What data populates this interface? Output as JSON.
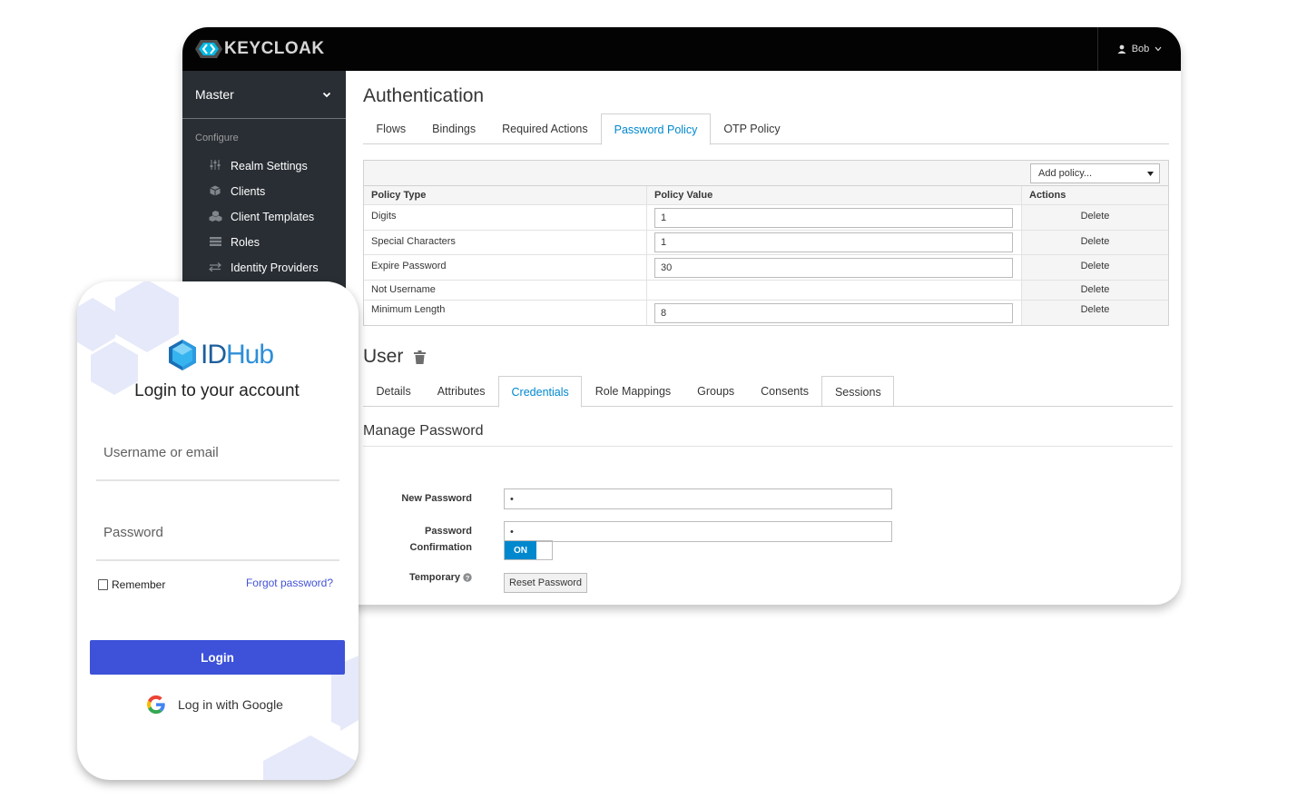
{
  "keycloak": {
    "brand": "KEYCLOAK",
    "user": "Bob",
    "realm": "Master",
    "section": "Configure",
    "nav": [
      {
        "label": "Realm Settings",
        "icon": "sliders-icon"
      },
      {
        "label": "Clients",
        "icon": "cube-icon"
      },
      {
        "label": "Client Templates",
        "icon": "cubes-icon"
      },
      {
        "label": "Roles",
        "icon": "list-icon"
      },
      {
        "label": "Identity Providers",
        "icon": "exchange-icon"
      }
    ],
    "auth_title": "Authentication",
    "auth_tabs": [
      "Flows",
      "Bindings",
      "Required Actions",
      "Password Policy",
      "OTP Policy"
    ],
    "add_policy": "Add policy...",
    "policy_headers": [
      "Policy Type",
      "Policy Value",
      "Actions"
    ],
    "policies": [
      {
        "type": "Digits",
        "value": "1",
        "action": "Delete"
      },
      {
        "type": "Special Characters",
        "value": "1",
        "action": "Delete"
      },
      {
        "type": "Expire Password",
        "value": "30",
        "action": "Delete"
      },
      {
        "type": "Not Username",
        "value": "",
        "action": "Delete"
      },
      {
        "type": "Minimum Length",
        "value": "8",
        "action": "Delete"
      }
    ],
    "user_title": "User",
    "user_tabs": [
      "Details",
      "Attributes",
      "Credentials",
      "Role Mappings",
      "Groups",
      "Consents",
      "Sessions"
    ],
    "manage_password": "Manage Password",
    "new_password_label": "New Password",
    "new_password_value": "•",
    "confirm_label_1": "Password",
    "confirm_label_2": "Confirmation",
    "confirm_value": "•",
    "temporary_label": "Temporary",
    "toggle_on": "ON",
    "reset_button": "Reset Password"
  },
  "idhub": {
    "logo_id": "ID",
    "logo_hub": "Hub",
    "heading": "Login to your account",
    "username_placeholder": "Username or email",
    "password_placeholder": "Password",
    "remember": "Remember",
    "forgot": "Forgot password?",
    "login_button": "Login",
    "google": "Log in with Google"
  }
}
